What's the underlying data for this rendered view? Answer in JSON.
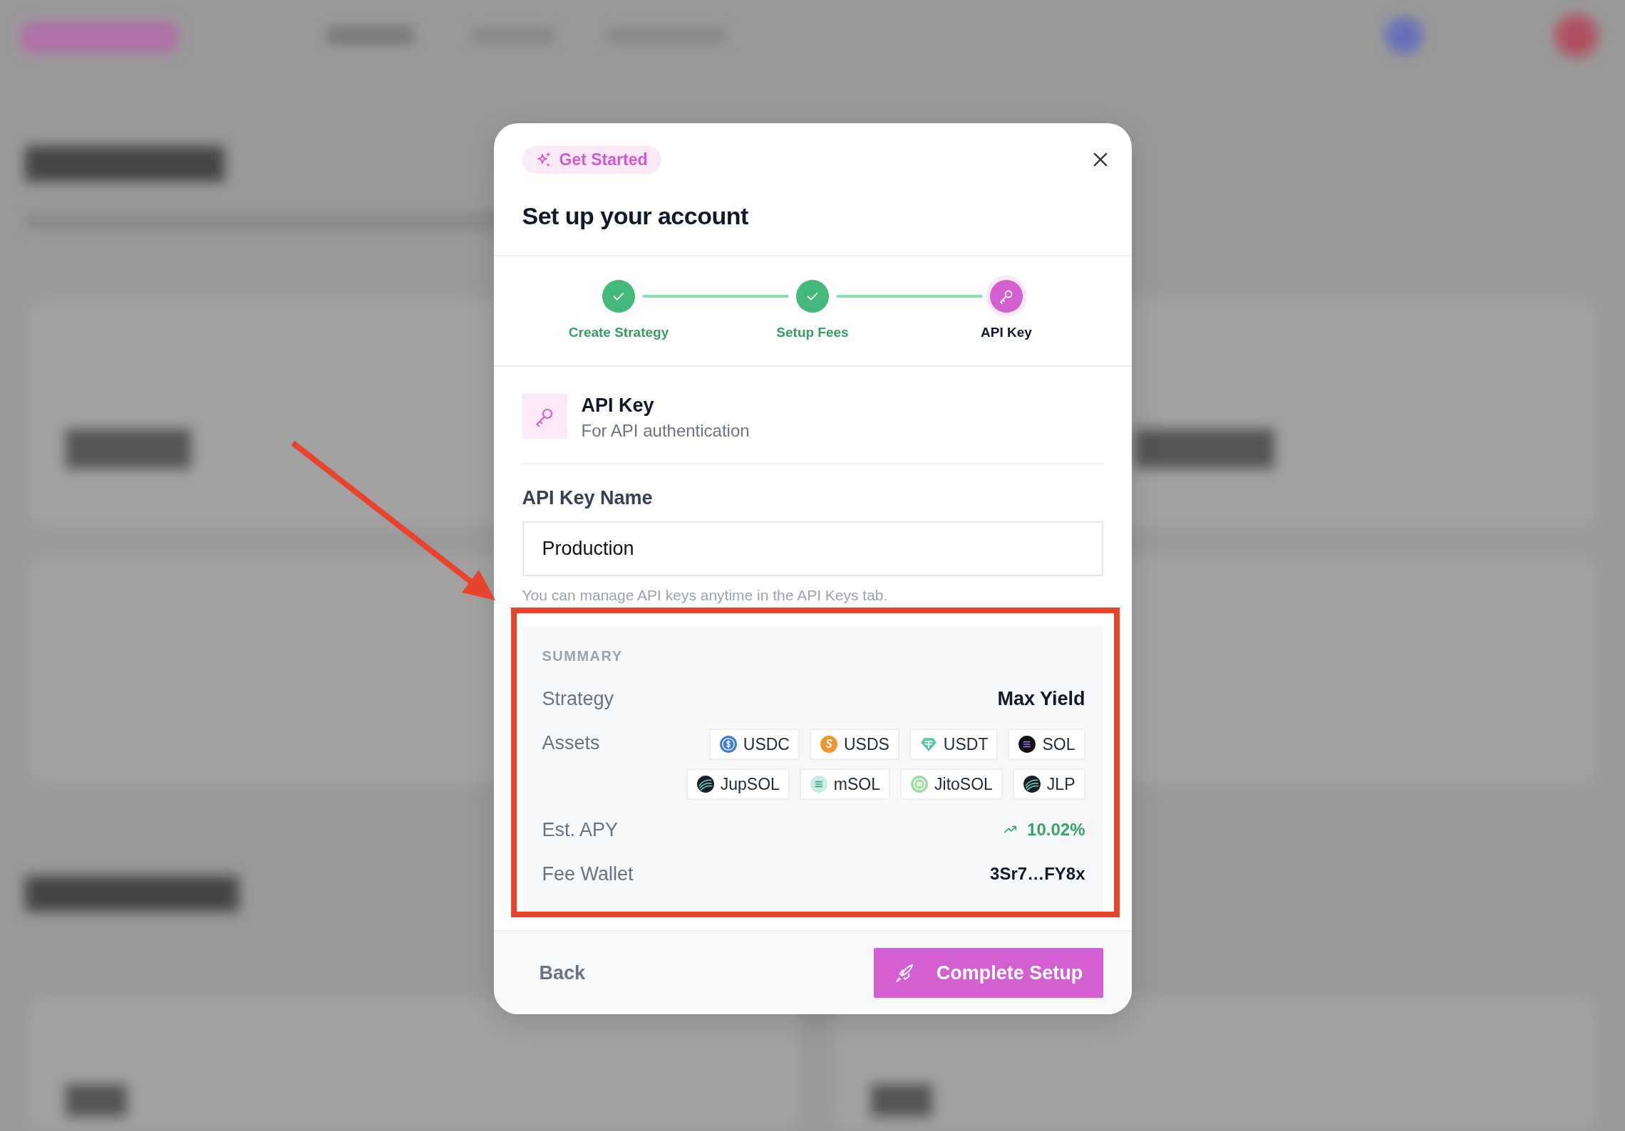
{
  "badge": {
    "label": "Get Started"
  },
  "title": "Set up your account",
  "steps": [
    {
      "label": "Create Strategy",
      "done": true,
      "selected": false
    },
    {
      "label": "Setup Fees",
      "done": true,
      "selected": false
    },
    {
      "label": "API Key",
      "done": false,
      "selected": true
    }
  ],
  "section": {
    "title": "API Key",
    "subtitle": "For API authentication"
  },
  "field": {
    "label": "API Key Name",
    "value": "Production",
    "help": "You can manage API keys anytime in the API Keys tab."
  },
  "summary": {
    "heading": "SUMMARY",
    "rows": [
      {
        "kind": "text",
        "label": "Strategy",
        "value": "Max Yield"
      },
      {
        "kind": "assets",
        "label": "Assets",
        "assets": [
          {
            "name": "USDC",
            "kind": "dollar"
          },
          {
            "name": "USDS",
            "kind": "s-coin"
          },
          {
            "name": "USDT",
            "kind": "tether"
          },
          {
            "name": "SOL",
            "kind": "bars"
          },
          {
            "name": "JupSOL",
            "kind": "stripes"
          },
          {
            "name": "mSOL",
            "kind": "light-bars"
          },
          {
            "name": "JitoSOL",
            "kind": "rings"
          },
          {
            "name": "JLP",
            "kind": "stripes"
          }
        ]
      },
      {
        "kind": "trend",
        "label": "Est. APY",
        "value": "10.02%"
      },
      {
        "kind": "text",
        "label": "Fee Wallet",
        "value": "3Sr7…FY8x"
      }
    ]
  },
  "footer": {
    "back": "Back",
    "submit": "Complete Setup"
  }
}
